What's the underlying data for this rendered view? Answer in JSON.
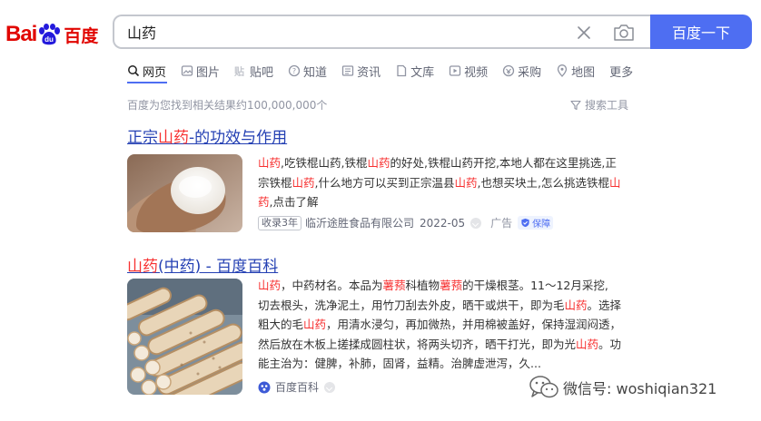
{
  "logo": {
    "bai": "Bai",
    "du": "du",
    "cn": "百度"
  },
  "search": {
    "query": "山药",
    "button_label": "百度一下"
  },
  "tabs": [
    {
      "label": "网页",
      "icon": "search-icon",
      "active": true
    },
    {
      "label": "图片",
      "icon": "image-icon"
    },
    {
      "label": "贴吧",
      "icon": "tieba-icon"
    },
    {
      "label": "知道",
      "icon": "question-icon"
    },
    {
      "label": "资讯",
      "icon": "news-icon"
    },
    {
      "label": "文库",
      "icon": "document-icon"
    },
    {
      "label": "视频",
      "icon": "video-icon"
    },
    {
      "label": "采购",
      "icon": "purchase-icon"
    },
    {
      "label": "地图",
      "icon": "map-pin-icon"
    },
    {
      "label": "更多",
      "icon": ""
    }
  ],
  "result_stat": "百度为您找到相关结果约100,000,000个",
  "search_tools": "搜索工具",
  "results": [
    {
      "title_parts": [
        "正宗",
        "山药",
        "-的功效与作用"
      ],
      "abstract_lines": [
        [
          "",
          "山药",
          ",吃铁棍山药,铁棍",
          "山药",
          "的好处,铁棍山药开挖,本地人都在这里挑选,正"
        ],
        [
          "宗铁棍",
          "山药",
          ",什么地方可以买到正宗温县",
          "山药",
          ",也想买块土,怎么挑选铁棍",
          "山",
          ""
        ],
        [
          "",
          "药",
          ",点击了解"
        ]
      ],
      "meta": {
        "badge": "收录3年",
        "source": "临沂途胜食品有限公司",
        "date": "2022-05",
        "ad": "广告",
        "secure": "保障"
      }
    },
    {
      "title_parts": [
        "山药",
        "(中药) - 百度百科"
      ],
      "abstract_lines": [
        [
          "",
          "山药",
          "，中药材名。本品为",
          "薯蓣",
          "科植物",
          "薯蓣",
          "的干燥根茎。11～12月采挖,"
        ],
        [
          "切去根头，洗净泥土，用竹刀刮去外皮，晒干或烘干，即为毛",
          "山药",
          "。选择"
        ],
        [
          "粗大的毛",
          "山药",
          "，用清水浸匀，再加微热，并用棉被盖好，保持湿润闷透，"
        ],
        [
          "然后放在木板上搓揉成圆柱状，将两头切齐，晒干打光，即为光",
          "山药",
          "。功"
        ],
        [
          "能主治为：健脾，补肺，固肾，益精。治脾虚泄泻，久..."
        ]
      ],
      "meta": {
        "source": "百度百科"
      }
    }
  ],
  "watermark": "微信号: woshiqian321",
  "colors": {
    "brand_blue": "#4e6ef2",
    "brand_red": "#e10602",
    "link": "#2440b3",
    "highlight": "#f73131"
  }
}
